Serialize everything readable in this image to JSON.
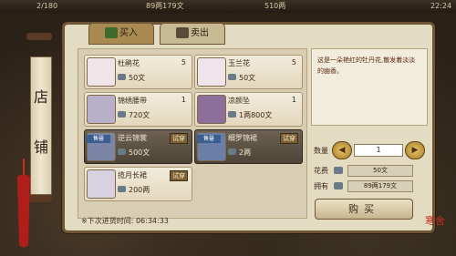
{
  "status_bar": {
    "stat1": "2/180",
    "money": "89两179文",
    "stat3": "510两",
    "time": "22:24"
  },
  "side_scroll": {
    "char1": "店",
    "char2": "铺"
  },
  "tabs": [
    {
      "label": "买入",
      "icon": "basket-icon"
    },
    {
      "label": "卖出",
      "icon": "bag-icon"
    }
  ],
  "items": [
    {
      "name": "杜鹃花",
      "count": "5",
      "price": "50文",
      "icon": "azalea-flower-icon",
      "tag": "",
      "thumb_tag": "",
      "selected": false
    },
    {
      "name": "玉兰花",
      "count": "5",
      "price": "50文",
      "icon": "magnolia-flower-icon",
      "tag": "",
      "thumb_tag": "",
      "selected": false
    },
    {
      "name": "锦绣腰带",
      "count": "1",
      "price": "720文",
      "icon": "belt-icon",
      "tag": "",
      "thumb_tag": "",
      "selected": false
    },
    {
      "name": "凉颜坠",
      "count": "1",
      "price": "1两800文",
      "icon": "pendant-icon",
      "tag": "",
      "thumb_tag": "",
      "selected": false
    },
    {
      "name": "逆云锦裳",
      "count": "",
      "price": "500文",
      "icon": "robe-icon",
      "tag": "试穿",
      "thumb_tag": "售罄",
      "selected": true
    },
    {
      "name": "细罗锦裙",
      "count": "",
      "price": "2两",
      "icon": "skirt-icon",
      "tag": "试穿",
      "thumb_tag": "售罄",
      "selected": true
    },
    {
      "name": "揽月长裙",
      "count": "",
      "price": "200两",
      "icon": "long-dress-icon",
      "tag": "试穿",
      "thumb_tag": "",
      "selected": false
    }
  ],
  "restock": {
    "label": "※下次进货时间:",
    "time": "06:34:33"
  },
  "description": "这是一朵艳红的牡丹花,散发着淡淡的幽香。",
  "purchase": {
    "qty_label": "数量",
    "qty_value": "1",
    "cost_label": "花费",
    "cost_value": "50文",
    "own_label": "拥有",
    "own_value": "89两179文",
    "buy_label": "购买",
    "minus": "◀",
    "plus": "▶"
  },
  "stamp_text": "寒舍",
  "colors": {
    "panel": "#e4dbc3",
    "frame": "#6e5535",
    "accent_red": "#c22a1f"
  }
}
